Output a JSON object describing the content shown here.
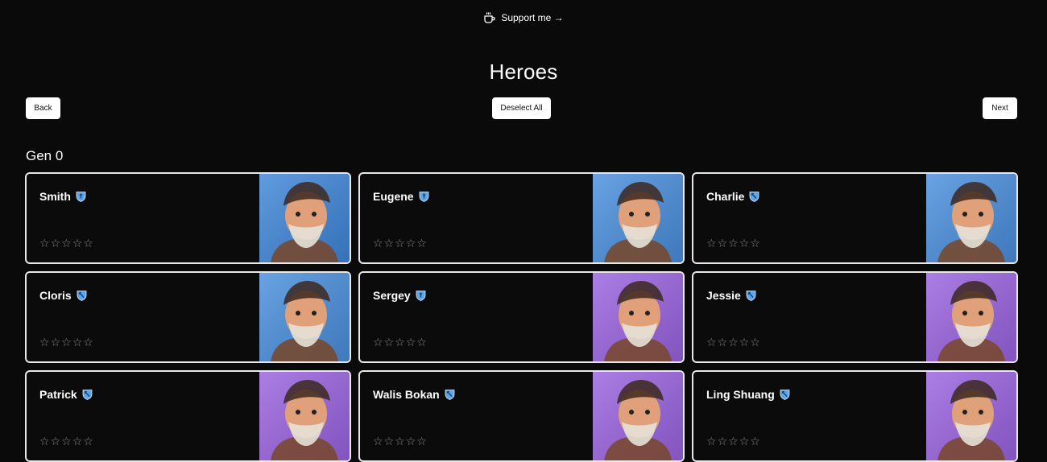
{
  "support": {
    "label": "Support me →",
    "icon": "coffee-cup-icon"
  },
  "page": {
    "title": "Heroes"
  },
  "buttons": {
    "back": "Back",
    "deselect_all": "Deselect All",
    "next": "Next"
  },
  "sections": [
    {
      "label": "Gen 0",
      "heroes": [
        {
          "name": "Smith",
          "badge": "shield",
          "rating": 0,
          "rating_max": 5,
          "bg": "#3f86d9"
        },
        {
          "name": "Eugene",
          "badge": "shield",
          "rating": 0,
          "rating_max": 5,
          "bg": "#4a8fdd"
        },
        {
          "name": "Charlie",
          "badge": "bow",
          "rating": 0,
          "rating_max": 5,
          "bg": "#4a8fdd"
        },
        {
          "name": "Cloris",
          "badge": "bow",
          "rating": 0,
          "rating_max": 5,
          "bg": "#4a8fdd"
        },
        {
          "name": "Sergey",
          "badge": "shield",
          "rating": 0,
          "rating_max": 5,
          "bg": "#9a63e0"
        },
        {
          "name": "Jessie",
          "badge": "bow",
          "rating": 0,
          "rating_max": 5,
          "bg": "#9a63e0"
        },
        {
          "name": "Patrick",
          "badge": "bow",
          "rating": 0,
          "rating_max": 5,
          "bg": "#9a63e0"
        },
        {
          "name": "Walis Bokan",
          "badge": "bow",
          "rating": 0,
          "rating_max": 5,
          "bg": "#9a63e0"
        },
        {
          "name": "Ling Shuang",
          "badge": "bow",
          "rating": 0,
          "rating_max": 5,
          "bg": "#9a63e0"
        }
      ]
    }
  ],
  "colors": {
    "background": "#0a0a0a",
    "card_border": "#e8e8e8",
    "badge_blue": "#5aa6e8",
    "star_empty": "#8a8a8a"
  }
}
